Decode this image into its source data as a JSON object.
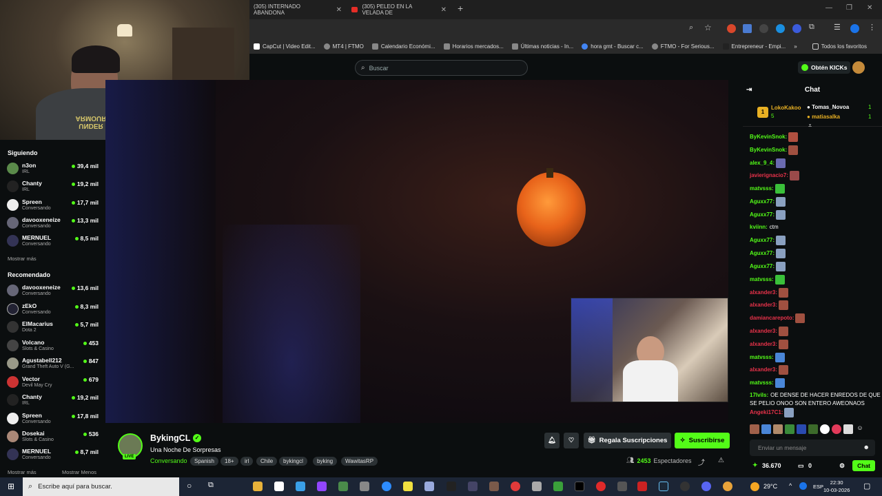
{
  "browser": {
    "tabs": [
      {
        "label": "(305) INTERNADO ABANDONA"
      },
      {
        "label": "(305) PELEO EN LA VELADA DE"
      }
    ],
    "new_tab": "+",
    "bookmarks": [
      "CapCut | Video Edit...",
      "MT4 | FTMO",
      "Calendario Económi...",
      "Horarios mercados...",
      "Últimas noticias - In...",
      "hora gmt - Buscar c...",
      "FTMO - For Serious...",
      "Entrepreneur - Empi..."
    ],
    "bookmarks_more": "»",
    "all_favorites": "Todos los favoritos"
  },
  "header": {
    "search_placeholder": "Buscar",
    "kicks_label": "Obtén KICKs"
  },
  "sidebar": {
    "following_title": "Siguiendo",
    "following": [
      {
        "name": "n3on",
        "category": "IRL",
        "viewers": "39,4 mil"
      },
      {
        "name": "Chanty",
        "category": "IRL",
        "viewers": "19,2 mil"
      },
      {
        "name": "Spreen",
        "category": "Conversando",
        "viewers": "17,7 mil"
      },
      {
        "name": "davooxeneize",
        "category": "Conversando",
        "viewers": "13,3 mil"
      },
      {
        "name": "MERNUEL",
        "category": "Conversando",
        "viewers": "8,5 mil"
      }
    ],
    "show_more_1": "Mostrar más",
    "recommended_title": "Recomendado",
    "recommended": [
      {
        "name": "davooxeneize",
        "category": "Conversando",
        "viewers": "13,6 mil"
      },
      {
        "name": "zEkO",
        "category": "Conversando",
        "viewers": "8,3 mil"
      },
      {
        "name": "ElMacarius",
        "category": "Dota 2",
        "viewers": "5,7 mil"
      },
      {
        "name": "Volcano",
        "category": "Slots & Casino",
        "viewers": "453"
      },
      {
        "name": "Agustabell212",
        "category": "Grand Theft Auto V (G...",
        "viewers": "847"
      },
      {
        "name": "Vector",
        "category": "Devil May Cry",
        "viewers": "679"
      },
      {
        "name": "Chanty",
        "category": "IRL",
        "viewers": "19,2 mil"
      },
      {
        "name": "Spreen",
        "category": "Conversando",
        "viewers": "17,8 mil"
      },
      {
        "name": "Dosekai",
        "category": "Slots & Casino",
        "viewers": "536"
      },
      {
        "name": "MERNUEL",
        "category": "Conversando",
        "viewers": "8,7 mil"
      }
    ],
    "show_more_2": "Mostrar más",
    "show_less": "Mostrar Menos"
  },
  "stream": {
    "streamer": "BykingCL",
    "live": "LIVE",
    "title": "Una Noche De Sorpresas",
    "category": "Conversando",
    "tags": [
      "Spanish",
      "18+",
      "irl",
      "Chile",
      "bykingcl",
      "byking",
      "WawitasRP"
    ],
    "gift_subs": "Regala Suscripciones",
    "subscribe": "Suscribirse",
    "viewer_count": "2453",
    "viewer_label": "Espectadores"
  },
  "chat": {
    "title": "Chat",
    "leaderboard": {
      "rank": "1",
      "top_user": "LokoKakoo",
      "top_count": "5",
      "users": [
        {
          "name": "Tomas_Novoa",
          "count": "1"
        },
        {
          "name": "matiasalka",
          "count": "1"
        }
      ]
    },
    "messages": [
      {
        "user": "ByKevinSnok:",
        "text": "",
        "color": "#53fc18"
      },
      {
        "user": "ByKevinSnok:",
        "text": "",
        "color": "#53fc18"
      },
      {
        "user": "alex_9_4:",
        "text": "",
        "color": "#53fc18"
      },
      {
        "user": "javierignacio7:",
        "text": "",
        "color": "#e8324a"
      },
      {
        "user": "matvsss:",
        "text": "",
        "color": "#53fc18"
      },
      {
        "user": "Aguxx77:",
        "text": "",
        "color": "#53fc18"
      },
      {
        "user": "Aguxx77:",
        "text": "",
        "color": "#53fc18"
      },
      {
        "user": "kviinn:",
        "text": "ctm",
        "color": "#53fc18"
      },
      {
        "user": "Aguxx77:",
        "text": "",
        "color": "#53fc18"
      },
      {
        "user": "Aguxx77:",
        "text": "",
        "color": "#53fc18"
      },
      {
        "user": "Aguxx77:",
        "text": "",
        "color": "#53fc18"
      },
      {
        "user": "matvsss:",
        "text": "",
        "color": "#53fc18"
      },
      {
        "user": "alxander3:",
        "text": "",
        "color": "#e8324a"
      },
      {
        "user": "alxander3:",
        "text": "",
        "color": "#e8324a"
      },
      {
        "user": "damiancarepoto:",
        "text": "",
        "color": "#e8324a"
      },
      {
        "user": "alxander3:",
        "text": "",
        "color": "#e8324a"
      },
      {
        "user": "alxander3:",
        "text": "",
        "color": "#e8324a"
      },
      {
        "user": "matvsss:",
        "text": "",
        "color": "#53fc18"
      },
      {
        "user": "alxander3:",
        "text": "",
        "color": "#e8324a"
      },
      {
        "user": "matvsss:",
        "text": "",
        "color": "#53fc18"
      },
      {
        "user": "17lvils:",
        "text": "OE DENSE DE HACER ENREDOS DE QUE",
        "color": "#53fc18"
      },
      {
        "user": "",
        "text": "SE PELIO ONOO SON ENTERO AWEONAOS",
        "color": "#53fc18"
      },
      {
        "user": "Angeki17C1:",
        "text": "",
        "color": "#e8324a"
      }
    ],
    "input_placeholder": "Enviar un mensaje",
    "points": "36.670",
    "balance": "0",
    "send_label": "Chat"
  },
  "taskbar": {
    "search_placeholder": "Escribe aquí para buscar.",
    "weather": "29°C",
    "language": "ESP",
    "time": "22:30",
    "date": "10-03-2026"
  }
}
